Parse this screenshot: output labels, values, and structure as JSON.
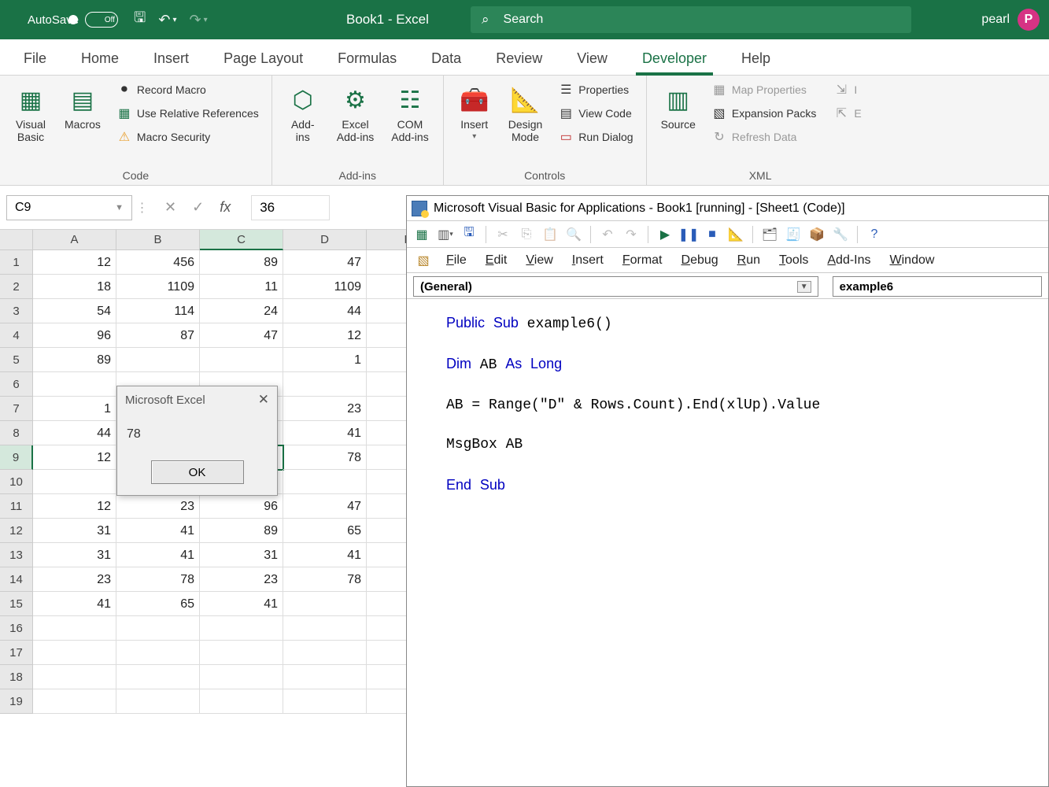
{
  "titlebar": {
    "autosave_label": "AutoSave",
    "autosave_state": "Off",
    "doc_title": "Book1 - Excel",
    "search_placeholder": "Search",
    "user_name": "pearl",
    "user_initial": "P"
  },
  "ribbon_tabs": [
    "File",
    "Home",
    "Insert",
    "Page Layout",
    "Formulas",
    "Data",
    "Review",
    "View",
    "Developer",
    "Help"
  ],
  "ribbon_active": "Developer",
  "ribbon": {
    "code": {
      "visual_basic": "Visual\nBasic",
      "macros": "Macros",
      "record_macro": "Record Macro",
      "use_relative": "Use Relative References",
      "macro_security": "Macro Security",
      "group": "Code"
    },
    "addins": {
      "addins": "Add-\nins",
      "excel_addins": "Excel\nAdd-ins",
      "com_addins": "COM\nAdd-ins",
      "group": "Add-ins"
    },
    "controls": {
      "insert": "Insert",
      "design_mode": "Design\nMode",
      "properties": "Properties",
      "view_code": "View Code",
      "run_dialog": "Run Dialog",
      "group": "Controls"
    },
    "xml": {
      "source": "Source",
      "map_props": "Map Properties",
      "expansion": "Expansion Packs",
      "refresh": "Refresh Data",
      "group": "XML"
    }
  },
  "formula_bar": {
    "cell_ref": "C9",
    "value": "36"
  },
  "grid": {
    "columns": [
      "A",
      "B",
      "C",
      "D",
      "E"
    ],
    "active_col_index": 2,
    "active_row_index": 8,
    "rows": [
      [
        "12",
        "456",
        "89",
        "47",
        ""
      ],
      [
        "18",
        "1109",
        "11",
        "1109",
        ""
      ],
      [
        "54",
        "114",
        "24",
        "44",
        ""
      ],
      [
        "96",
        "87",
        "47",
        "12",
        ""
      ],
      [
        "89",
        "",
        "",
        "1",
        ""
      ],
      [
        "",
        "",
        "",
        "",
        ""
      ],
      [
        "1",
        "",
        "",
        "23",
        ""
      ],
      [
        "44",
        "",
        "",
        "41",
        ""
      ],
      [
        "12",
        "",
        "",
        "78",
        ""
      ],
      [
        "",
        "",
        "",
        "",
        ""
      ],
      [
        "12",
        "23",
        "96",
        "47",
        ""
      ],
      [
        "31",
        "41",
        "89",
        "65",
        ""
      ],
      [
        "31",
        "41",
        "31",
        "41",
        ""
      ],
      [
        "23",
        "78",
        "23",
        "78",
        ""
      ],
      [
        "41",
        "65",
        "41",
        "",
        ""
      ],
      [
        "",
        "",
        "",
        "",
        ""
      ],
      [
        "",
        "",
        "",
        "",
        ""
      ],
      [
        "",
        "",
        "",
        "",
        ""
      ],
      [
        "",
        "",
        "",
        "",
        ""
      ]
    ]
  },
  "msgbox": {
    "title": "Microsoft Excel",
    "body": "78",
    "ok": "OK"
  },
  "vba": {
    "title": "Microsoft Visual Basic for Applications - Book1 [running] - [Sheet1 (Code)]",
    "menu": [
      "File",
      "Edit",
      "View",
      "Insert",
      "Format",
      "Debug",
      "Run",
      "Tools",
      "Add-Ins",
      "Window"
    ],
    "dd_left": "(General)",
    "dd_right": "example6",
    "code_lines": [
      {
        "t": "Public Sub example6()",
        "kw": [
          "Public",
          "Sub"
        ]
      },
      {
        "t": ""
      },
      {
        "t": "Dim AB As Long",
        "kw": [
          "Dim",
          "As",
          "Long"
        ]
      },
      {
        "t": ""
      },
      {
        "t": "AB = Range(\"D\" & Rows.Count).End(xlUp).Value"
      },
      {
        "t": ""
      },
      {
        "t": "MsgBox AB"
      },
      {
        "t": ""
      },
      {
        "t": "End Sub",
        "kw": [
          "End",
          "Sub"
        ]
      }
    ]
  }
}
